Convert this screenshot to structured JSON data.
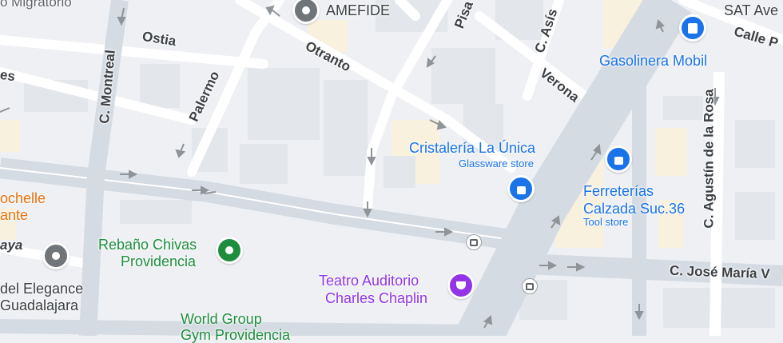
{
  "streets": {
    "migratorio": "o Migratorio",
    "ostia": "Ostia",
    "otranto": "Otranto",
    "pisa": "Pisa",
    "asis": "C. Asís",
    "verona": "Verona",
    "montreal": "C. Montreal",
    "palermo": "Palermo",
    "es": "es",
    "calle_p": "Calle P",
    "agustin": "C. Agustín de la Rosa",
    "jose_maria": "C. José María V",
    "aya": "aya"
  },
  "pois": {
    "amefide": "AMEFIDE",
    "sat": "SAT Ave",
    "gasolinera": "Gasolinera Mobil",
    "cristaleria": "Cristalería La Única",
    "cristaleria_type": "Glassware store",
    "ferreterias_1": "Ferreterías",
    "ferreterias_2": "Calzada Suc.36",
    "ferreterias_type": "Tool store",
    "rochelle_1": "ochelle",
    "rochelle_2": "ante",
    "rebano_1": "Rebaño Chivas",
    "rebano_2": "Providencia",
    "elegance_1": "del Elegance",
    "elegance_2": "Guadalajara",
    "teatro_1": "Teatro Auditorio",
    "teatro_2": "Charles Chaplin",
    "world_1": "World Group",
    "world_2": "Gym Providencia"
  },
  "icons": {
    "pin_gray": "location-pin-icon",
    "pin_green": "park-pin-icon",
    "pin_blue_shop": "shopping-bag-icon",
    "pin_purple": "theater-masks-icon",
    "pin_gas": "gas-station-icon",
    "bus": "bus-stop-icon"
  },
  "colors": {
    "road": "#ffffff",
    "avenue": "#d5dbe3",
    "block": "#e8eaed",
    "poi_green": "#1e8e3e",
    "poi_blue": "#1a73e8",
    "poi_purple": "#9334e6",
    "poi_orange": "#e8710a",
    "commercial": "#fef7e0"
  }
}
